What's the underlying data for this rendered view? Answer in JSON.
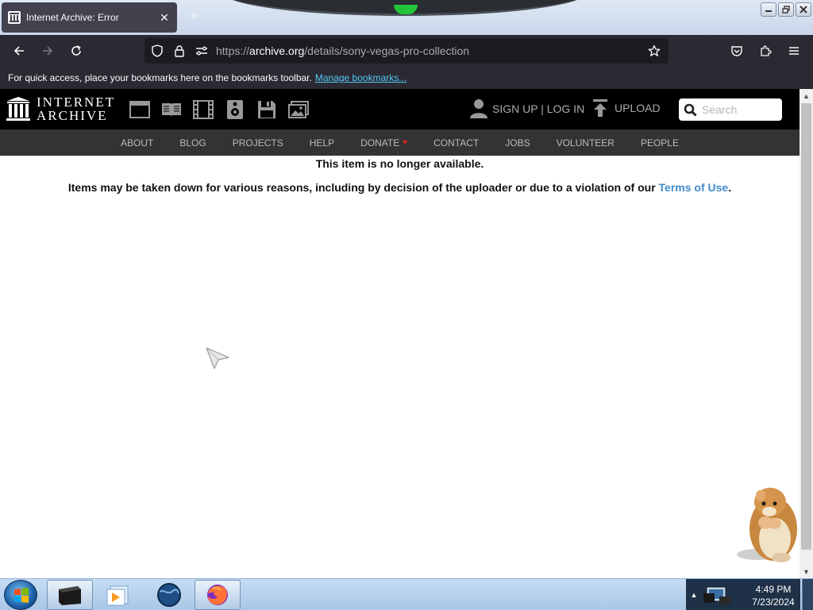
{
  "browser": {
    "tab_title": "Internet Archive: Error",
    "tab_close": "✕",
    "new_tab": "+",
    "url_host": "archive.org",
    "url_prefix": "https://",
    "url_path": "/details/sony-vegas-pro-collection",
    "bookmarks_text": "For quick access, place your bookmarks here on the bookmarks toolbar.",
    "bookmarks_link": "Manage bookmarks..."
  },
  "site": {
    "logo_line1": "INTERNET",
    "logo_line2": "ARCHIVE",
    "media_icons": [
      "web-icon",
      "texts-icon",
      "video-icon",
      "audio-icon",
      "software-icon",
      "images-icon"
    ],
    "user_label": "SIGN UP | LOG IN",
    "upload_label": "UPLOAD",
    "search_placeholder": "Search",
    "nav": [
      "ABOUT",
      "BLOG",
      "PROJECTS",
      "HELP",
      "DONATE",
      "CONTACT",
      "JOBS",
      "VOLUNTEER",
      "PEOPLE"
    ],
    "donate_heart": "♥",
    "colors": {
      "link": "#428bca",
      "nav_bg": "#333333",
      "top_bg": "#000000",
      "donate_heart": "#e0201a"
    }
  },
  "page": {
    "message_main": "This item is no longer available.",
    "message_sub": "Items may be taken down for various reasons, including by decision of the uploader or due to a violation of our",
    "terms_link": "Terms of Use",
    "terms_suffix": "."
  },
  "taskbar": {
    "apps": [
      "terminal-app",
      "media-player-app",
      "globe-app",
      "firefox-app"
    ],
    "time": "4:49 PM",
    "date": "7/23/2024",
    "tray_arrow": "▲"
  }
}
